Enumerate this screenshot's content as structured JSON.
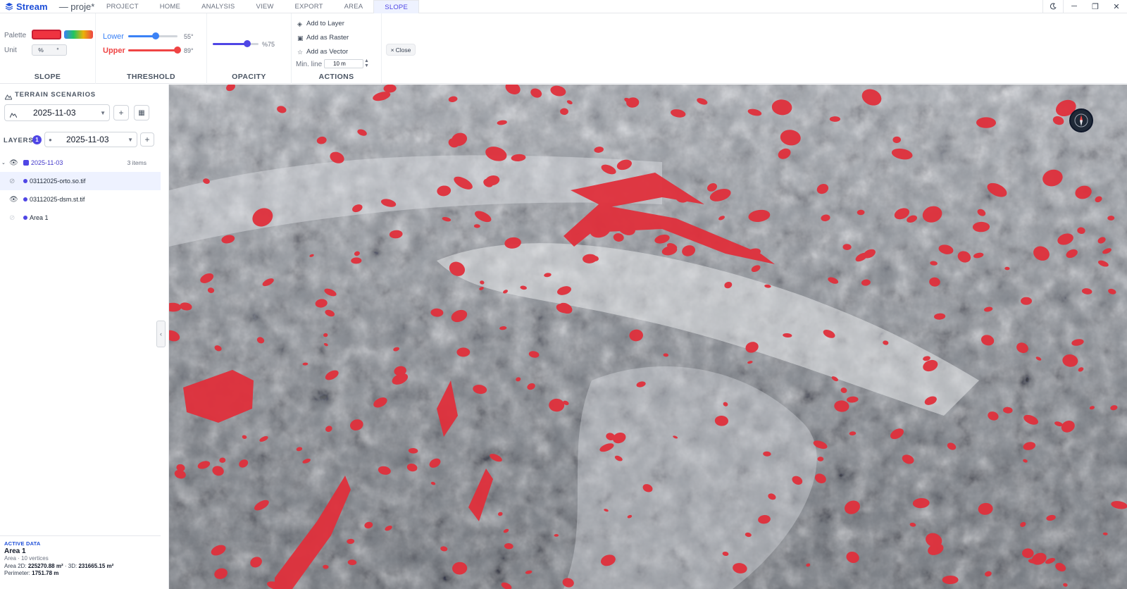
{
  "app": {
    "brand": "Stream",
    "project": "— proje*"
  },
  "menu": {
    "tabs": [
      "PROJECT",
      "HOME",
      "ANALYSIS",
      "VIEW",
      "EXPORT",
      "AREA",
      "SLOPE"
    ],
    "active": "SLOPE"
  },
  "window": {
    "theme_icon": "moon-icon",
    "minimize": "─",
    "maximize": "❐",
    "close": "✕"
  },
  "ribbon": {
    "slope": {
      "label": "SLOPE",
      "palette_label": "Palette",
      "unit_label": "Unit",
      "unit_options": [
        "%",
        "°"
      ],
      "palette_colors": {
        "solid": "#ef3340",
        "gradient": [
          "#3b82f6",
          "#22c55e",
          "#eab308",
          "#ef4444"
        ]
      }
    },
    "threshold": {
      "label": "THRESHOLD",
      "lower_label": "Lower",
      "lower_value": "55°",
      "lower_level": 0.55,
      "upper_label": "Upper",
      "upper_value": "89°",
      "upper_level": 1.0,
      "lower_color": "#3b82f6",
      "upper_color": "#ef4444"
    },
    "opacity": {
      "label": "OPACITY",
      "value": "%75",
      "level": 0.75,
      "color": "#4f46e5"
    },
    "actions": {
      "label": "ACTIONS",
      "add_to_layer": "Add to Layer",
      "add_as_raster": "Add as Raster",
      "add_as_vector": "Add as Vector",
      "min_line_label": "Min. line",
      "min_line_value": "10 m"
    },
    "close_label": "Close"
  },
  "sidebar": {
    "terrain_title": "TERRAIN SCENARIOS",
    "scenario": "2025-11-03",
    "layers_title": "LAYERS",
    "layers_count": "1",
    "layers_date": "2025-11-03",
    "layers": [
      {
        "name": "2025-11-03",
        "count": "3 items",
        "visible": true,
        "group": true
      },
      {
        "name": "03112025-orto.so.tif",
        "visible": false,
        "selected": true
      },
      {
        "name": "03112025-dsm.st.tif",
        "visible": true
      },
      {
        "name": "Area 1",
        "visible": false
      }
    ],
    "active_data": {
      "title": "ACTIVE DATA",
      "name": "Area 1",
      "sub": "Area · 10 vertices",
      "area_prefix": "Area 2D:",
      "area2d": "225270.88 m²",
      "area3d_prefix": "· 3D:",
      "area3d": "231665.15 m²",
      "perimeter_prefix": "Perimeter:",
      "perimeter": "1751.78 m"
    }
  },
  "colors": {
    "accent": "#4f46e5",
    "brand": "#1d4ed8",
    "slope_red": "#e0303c"
  }
}
